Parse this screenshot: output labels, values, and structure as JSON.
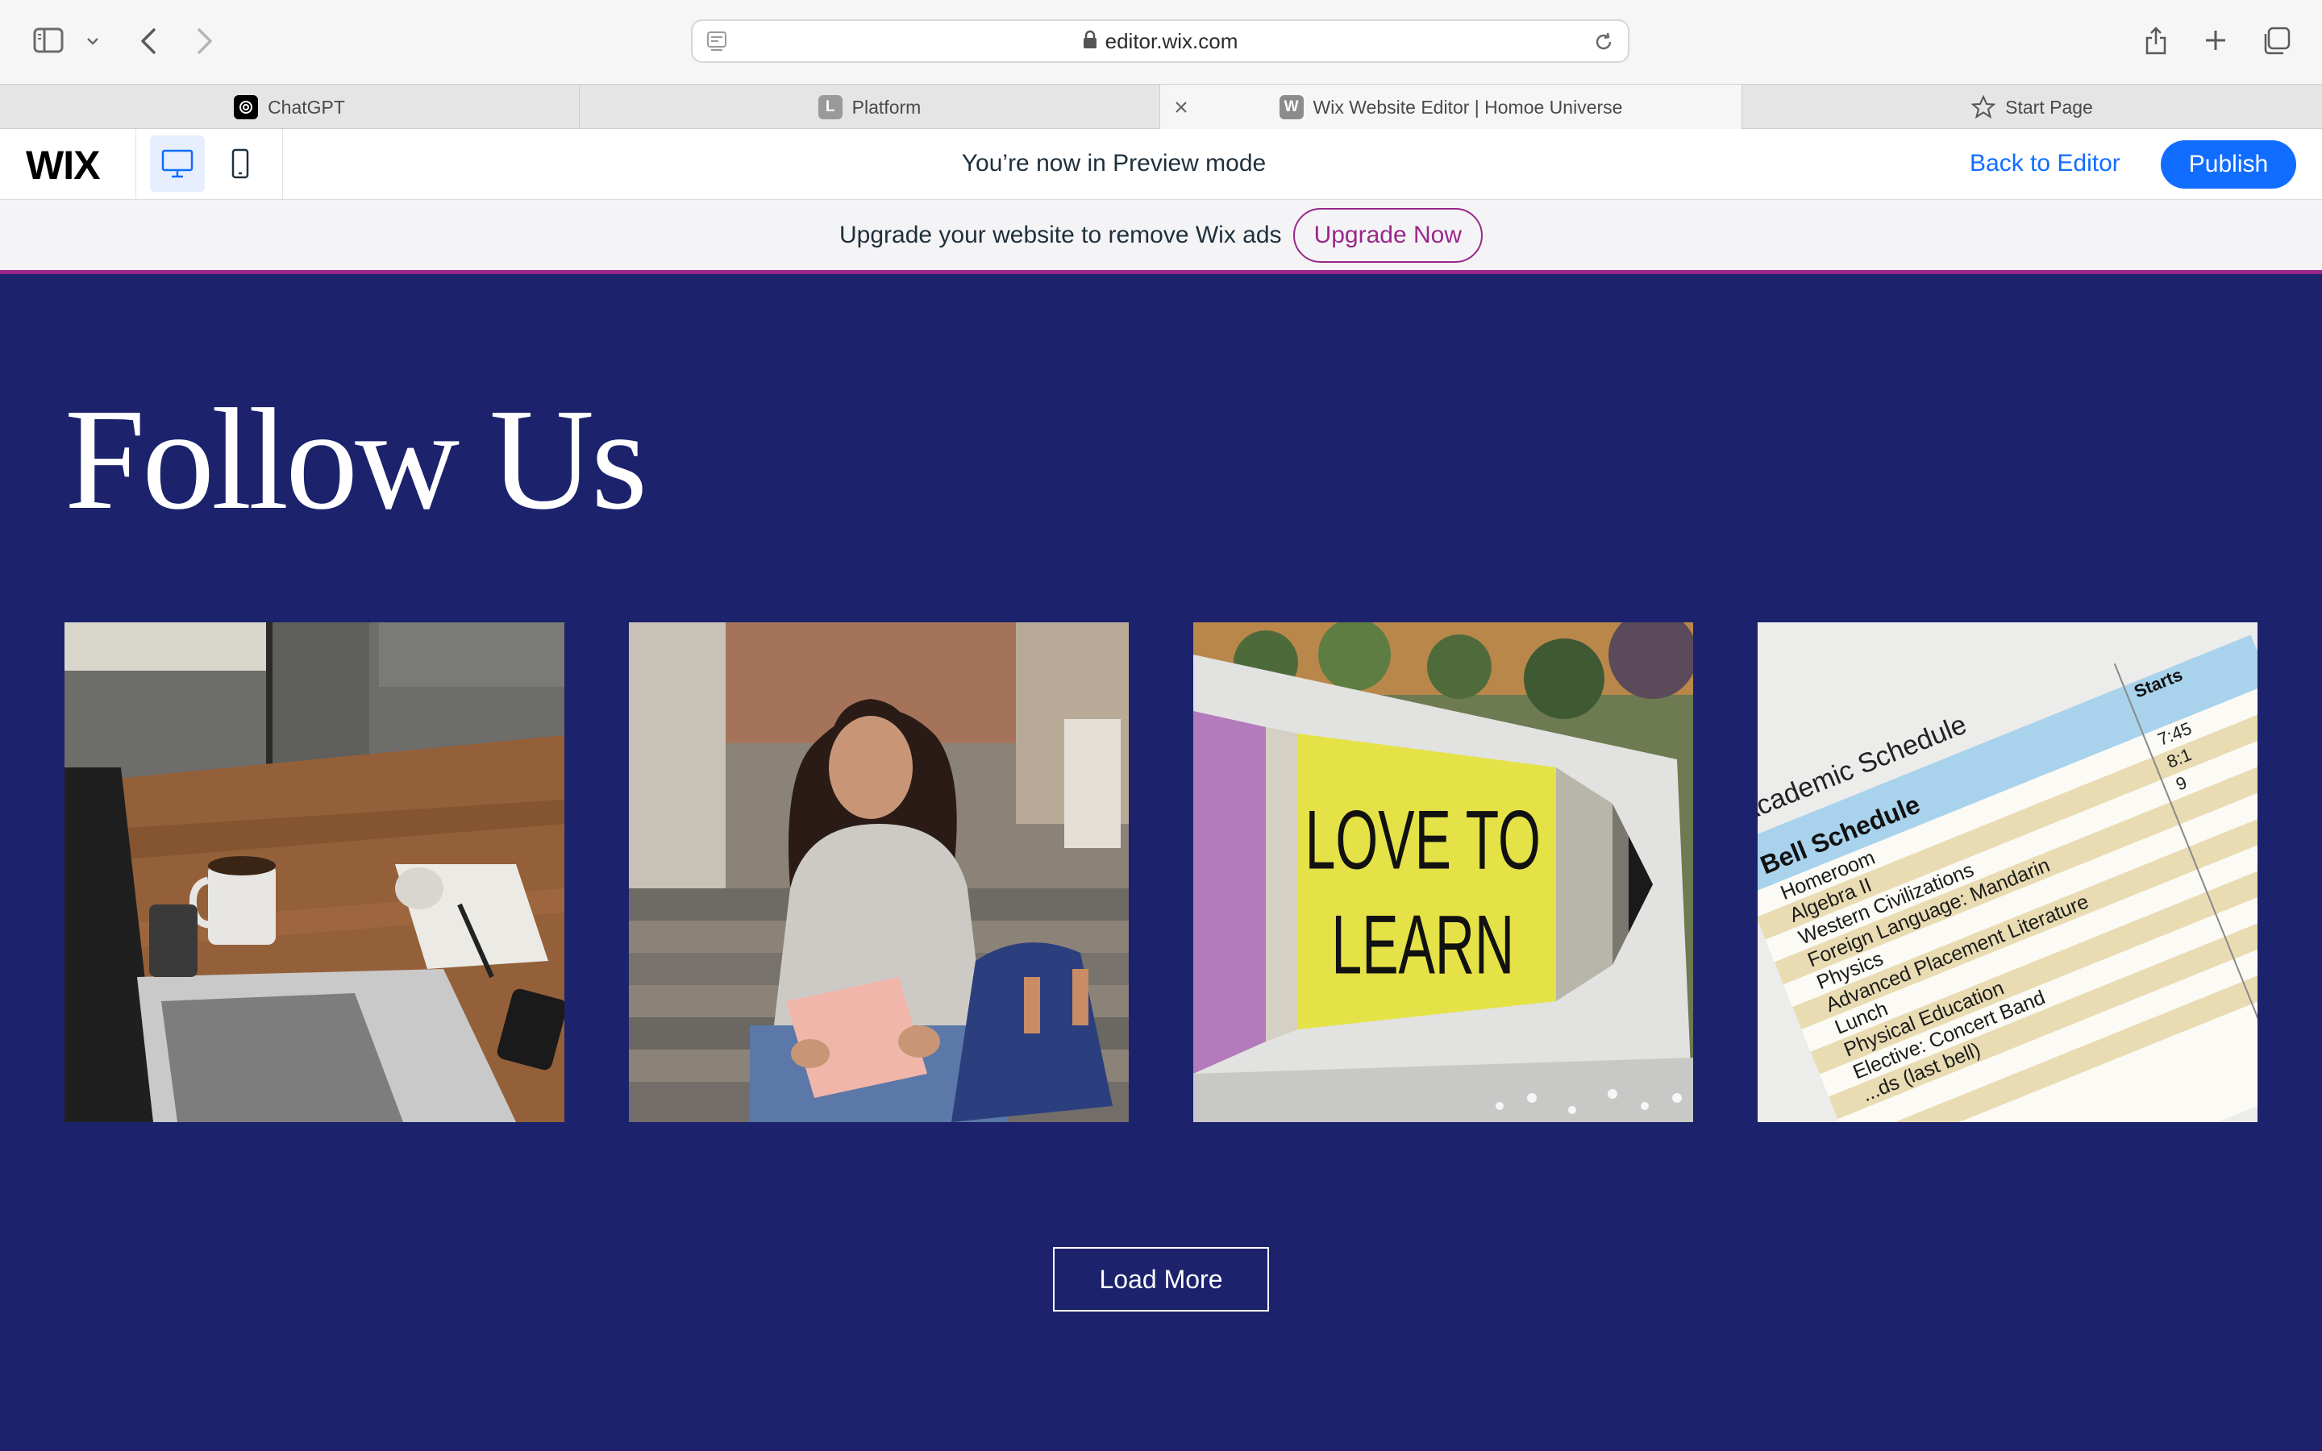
{
  "browser": {
    "url": "editor.wix.com",
    "tabs": [
      {
        "title": "ChatGPT",
        "icon": "chatgpt-icon"
      },
      {
        "title": "Platform",
        "icon": "L"
      },
      {
        "title": "Wix Website Editor | Homoe Universe",
        "icon": "W"
      },
      {
        "title": "Start Page",
        "icon": "star-icon"
      }
    ],
    "active_tab": 2
  },
  "wix_bar": {
    "logo": "WIX",
    "preview_text": "You’re now in Preview mode",
    "back_label": "Back to Editor",
    "publish_label": "Publish"
  },
  "upgrade": {
    "text": "Upgrade your website to remove Wix ads",
    "button": "Upgrade Now"
  },
  "section": {
    "title": "Follow Us",
    "load_more": "Load More",
    "pencil_text_line1": "LOVE TO",
    "pencil_text_line2": "LEARN",
    "schedule": {
      "heading": "Academic Schedule",
      "subheading": "Bell Schedule",
      "starts_header": "Starts",
      "times": [
        "7:45",
        "8:1",
        "9"
      ],
      "rows": [
        "Homeroom",
        "Algebra II",
        "Western Civilizations",
        "Foreign Language: Mandarin",
        "Physics",
        "Advanced Placement Literature",
        "Lunch",
        "Physical Education",
        "Elective: Concert Band",
        "...ds (last bell)"
      ]
    }
  },
  "colors": {
    "page_bg": "#1c236c",
    "wix_blue": "#116dff",
    "upgrade_purple": "#9a2789"
  }
}
